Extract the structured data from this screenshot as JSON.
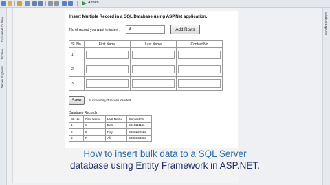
{
  "toolbar": {
    "attach_label": "Attach..."
  },
  "side_panels": {
    "left": [
      "Document Outline",
      "Toolbox",
      "Server Explorer"
    ],
    "right": "Solution Explorer"
  },
  "form": {
    "title": "Insert Multiple Record in a SQL Database using ASP.Net application.",
    "record_count_label": "No of record you want to insert :",
    "record_count_value": "3",
    "add_rows_label": "Add Rows",
    "columns": [
      "SL No.",
      "First Name",
      "Last Name",
      "Contact No"
    ],
    "rows": [
      "1",
      "2",
      "3"
    ],
    "save_label": "Save",
    "status_message": "Successfully 3 record inserted."
  },
  "database": {
    "title": "Database Records",
    "columns": [
      "SL No.",
      "First Name",
      "Last Name",
      "Contact No"
    ],
    "rows": [
      [
        "1",
        "S",
        "Das",
        "9811111111"
      ],
      [
        "2",
        "D",
        "Roy",
        "9822222222"
      ],
      [
        "3",
        "R",
        "Ali",
        "9833333333"
      ]
    ]
  },
  "caption": {
    "line1": "How to insert bulk data to a SQL Server",
    "line2": "database using Entity Framework in ASP.NET."
  }
}
